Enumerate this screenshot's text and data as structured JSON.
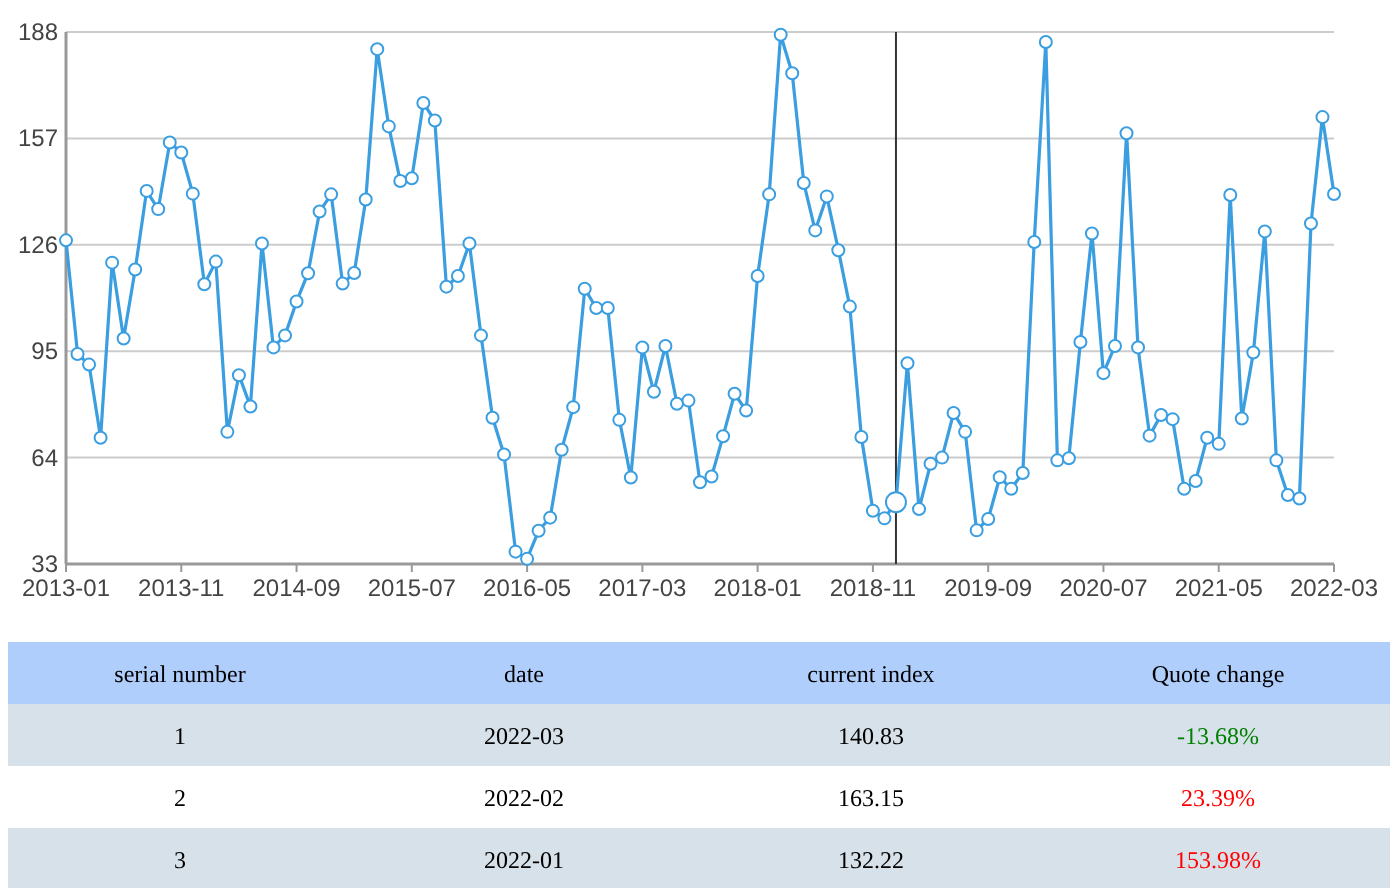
{
  "chart": {
    "chart_data": {
      "type": "line",
      "categories": [
        "2013-01",
        null,
        null,
        null,
        null,
        null,
        null,
        null,
        null,
        null,
        "2013-11",
        null,
        null,
        null,
        null,
        null,
        null,
        null,
        null,
        null,
        "2014-09",
        null,
        null,
        null,
        null,
        null,
        null,
        null,
        null,
        null,
        "2015-07",
        null,
        null,
        null,
        null,
        null,
        null,
        null,
        null,
        null,
        "2016-05",
        null,
        null,
        null,
        null,
        null,
        null,
        null,
        null,
        null,
        "2017-03",
        null,
        null,
        null,
        null,
        null,
        null,
        null,
        null,
        null,
        "2018-01",
        null,
        null,
        null,
        null,
        null,
        null,
        null,
        null,
        null,
        "2018-11",
        null,
        null,
        null,
        null,
        null,
        null,
        null,
        null,
        null,
        "2019-09",
        null,
        null,
        null,
        null,
        null,
        null,
        null,
        null,
        null,
        "2020-07",
        null,
        null,
        null,
        null,
        null,
        null,
        null,
        null,
        null,
        "2021-05",
        null,
        null,
        null,
        null,
        null,
        null,
        null,
        null,
        null,
        "2022-03"
      ],
      "series": [
        {
          "color": "#3a9ee0",
          "marker": "circle",
          "values": [
            127.3,
            94.2,
            91.1,
            69.8,
            120.8,
            98.7,
            118.8,
            141.7,
            136.4,
            155.8,
            152.9,
            140.9,
            114.5,
            121.1,
            71.5,
            88.0,
            78.9,
            126.4,
            96.1,
            99.6,
            109.5,
            117.7,
            135.7,
            140.7,
            114.7,
            117.8,
            139.2,
            183.0,
            160.5,
            144.6,
            145.4,
            167.3,
            162.2,
            113.8,
            116.9,
            126.4,
            99.6,
            75.6,
            64.9,
            36.6,
            34.5,
            42.7,
            46.5,
            66.3,
            78.7,
            113.2,
            107.6,
            107.6,
            75.0,
            58.2,
            96.1,
            83.2,
            96.5,
            79.7,
            80.6,
            56.8,
            58.5,
            70.2,
            82.6,
            77.7,
            116.9,
            140.7,
            187.2,
            176.0,
            144.0,
            130.2,
            140.1,
            124.4,
            108.0,
            70.0,
            48.5,
            46.3,
            51.0,
            91.5,
            49.0,
            62.2,
            64.0,
            77.0,
            71.5,
            42.8,
            46.1,
            58.3,
            54.9,
            59.5,
            126.8,
            185.1,
            63.2,
            63.8,
            97.7,
            129.3,
            88.6,
            96.5,
            158.5,
            96.1,
            70.4,
            76.4,
            75.2,
            54.9,
            57.2,
            69.8,
            68.0,
            140.5,
            75.4,
            94.6,
            129.9,
            63.2,
            53.1,
            52.1,
            132.2,
            163.2,
            140.8
          ]
        }
      ],
      "ylim": [
        33,
        188
      ],
      "yticks": [
        33,
        64,
        95,
        126,
        157,
        188
      ],
      "grid": true
    }
  },
  "table": {
    "columns": [
      "serial number",
      "date",
      "current index",
      "Quote change"
    ],
    "rows": [
      {
        "cells": [
          "1",
          "2022-03",
          "140.83",
          "-13.68%"
        ],
        "color": "#008000"
      },
      {
        "cells": [
          "2",
          "2022-02",
          "163.15",
          "23.39%"
        ],
        "color": "#ff0000"
      },
      {
        "cells": [
          "3",
          "2022-01",
          "132.22",
          "153.98%"
        ],
        "color": "#ff0000"
      }
    ]
  }
}
